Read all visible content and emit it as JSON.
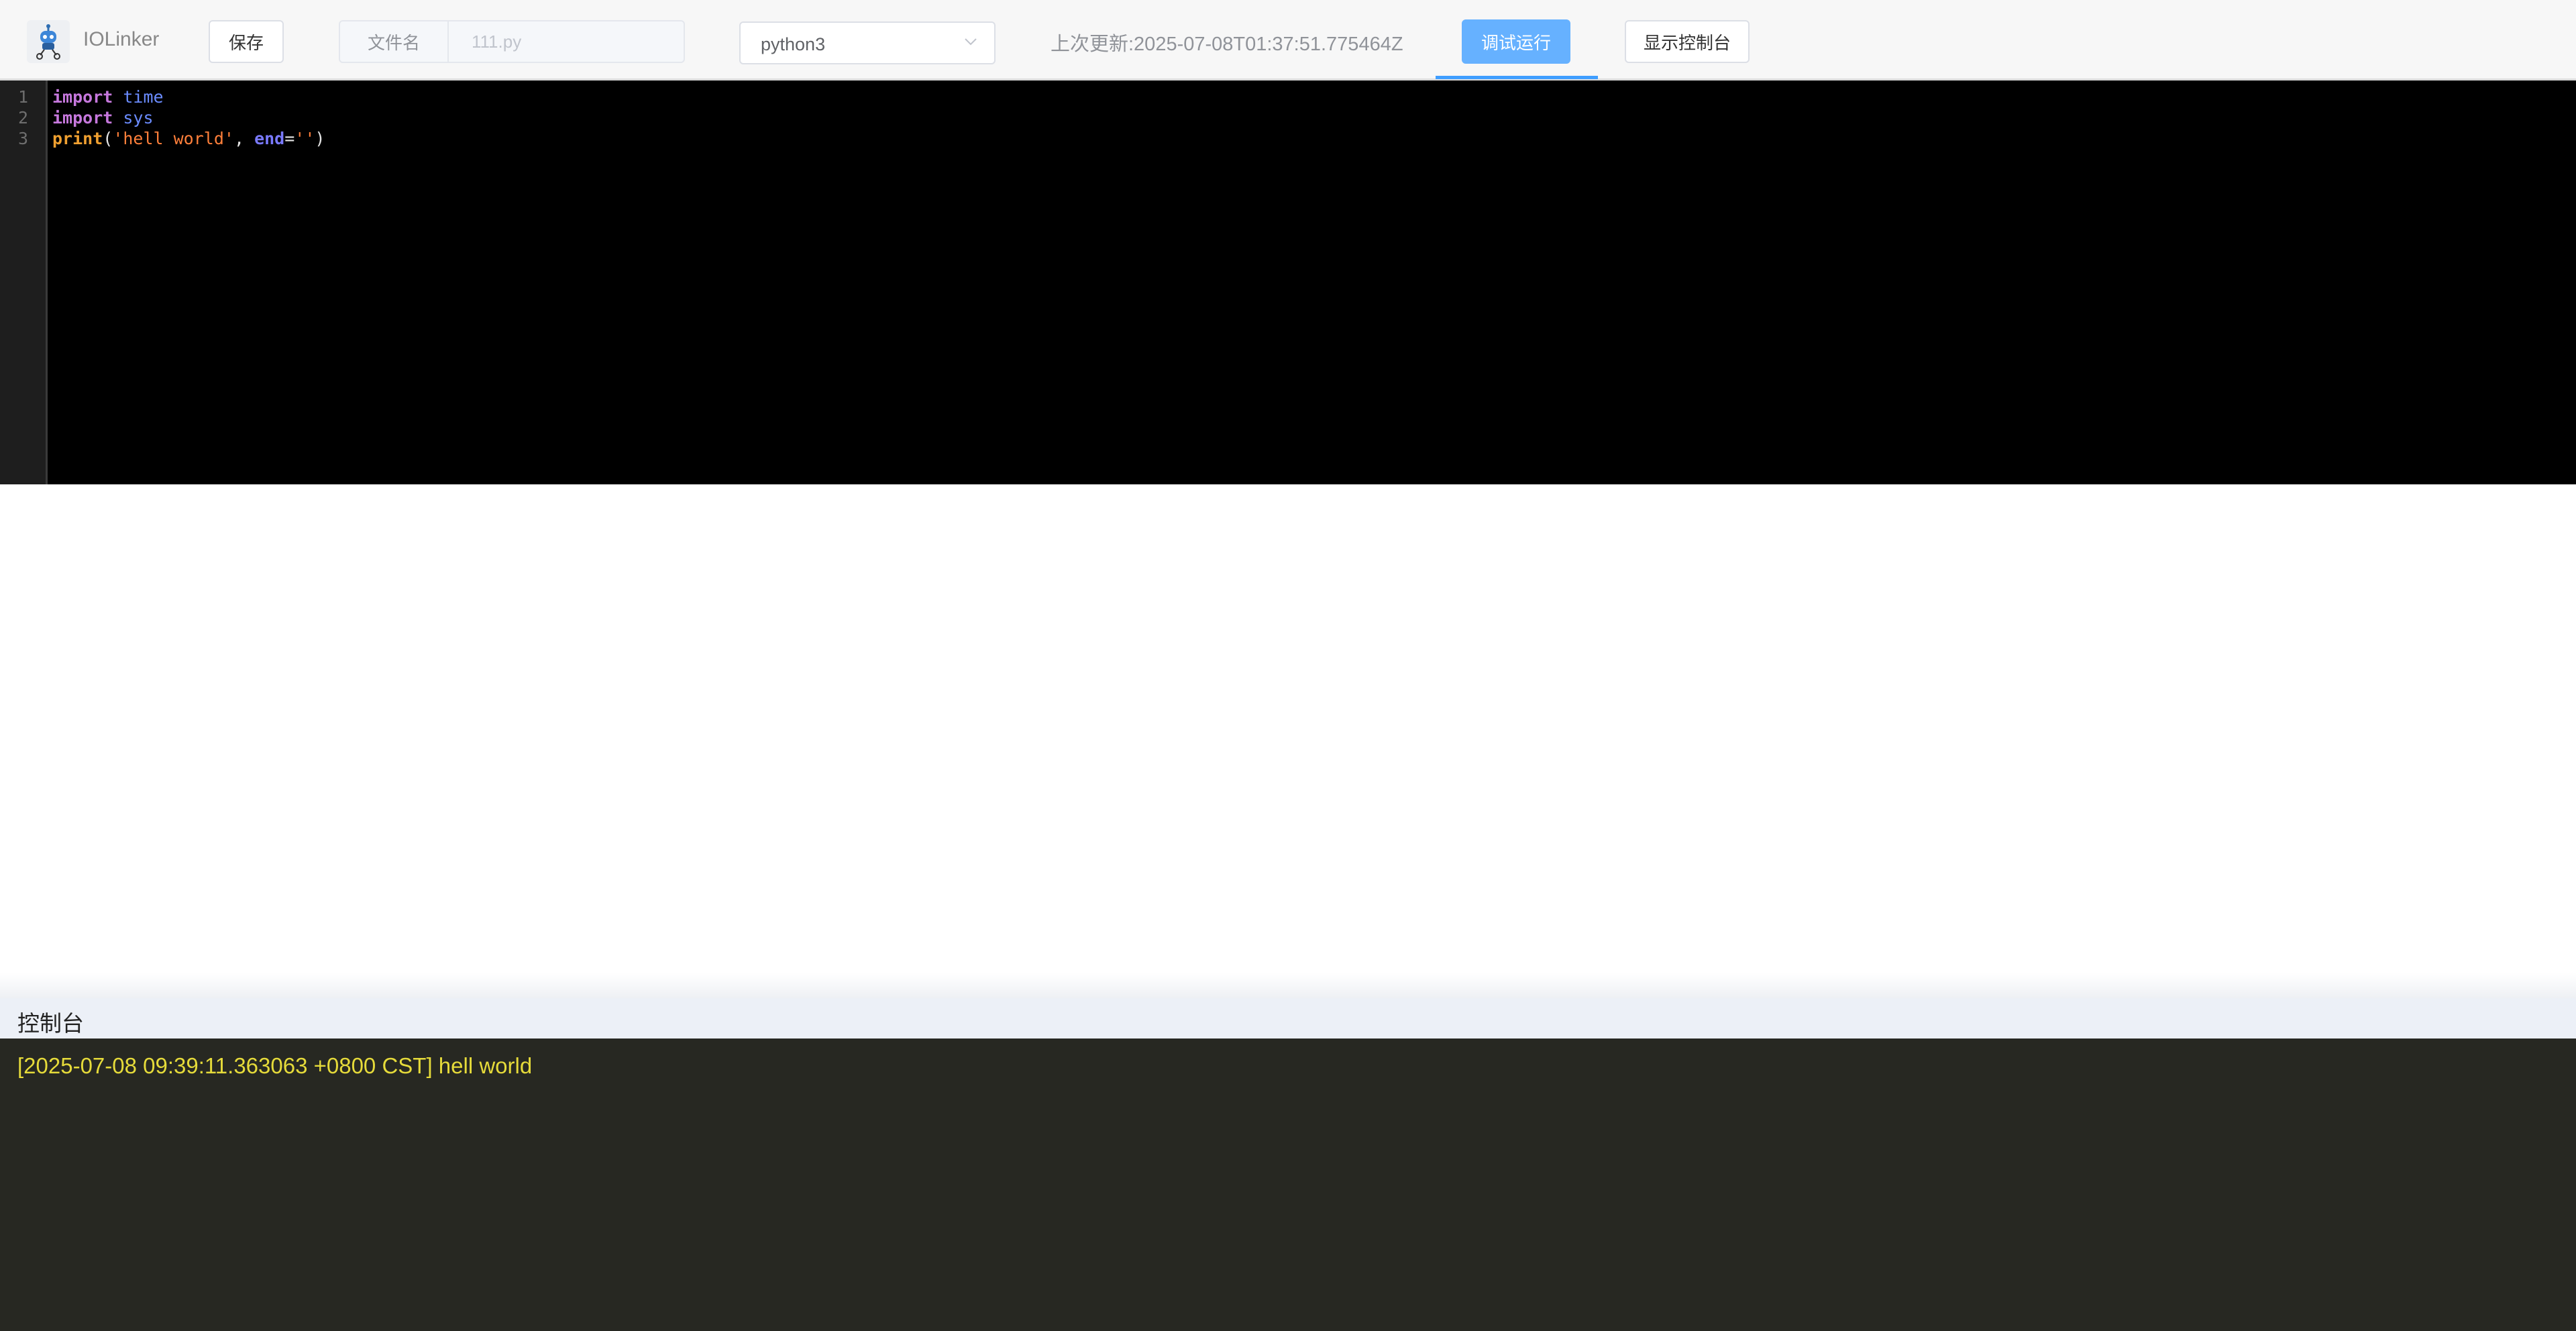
{
  "app": {
    "name": "IOLinker"
  },
  "toolbar": {
    "save_label": "保存",
    "filename_label": "文件名",
    "filename_placeholder": "111.py",
    "language_selected": "python3",
    "last_update": "上次更新:2025-07-08T01:37:51.775464Z",
    "run_label": "调试运行",
    "console_toggle_label": "显示控制台"
  },
  "editor": {
    "line_numbers": [
      "1",
      "2",
      "3"
    ],
    "lines": [
      [
        {
          "t": "import",
          "c": "kw"
        },
        {
          "t": " ",
          "c": "pun"
        },
        {
          "t": "time",
          "c": "mod"
        }
      ],
      [
        {
          "t": "import",
          "c": "kw"
        },
        {
          "t": " ",
          "c": "pun"
        },
        {
          "t": "sys",
          "c": "mod"
        }
      ],
      [
        {
          "t": "print",
          "c": "fn"
        },
        {
          "t": "(",
          "c": "pun"
        },
        {
          "t": "'hell world'",
          "c": "str"
        },
        {
          "t": ", ",
          "c": "pun"
        },
        {
          "t": "end",
          "c": "param"
        },
        {
          "t": "=",
          "c": "pun"
        },
        {
          "t": "''",
          "c": "str"
        },
        {
          "t": ")",
          "c": "pun"
        }
      ]
    ]
  },
  "console": {
    "title": "控制台",
    "logs": [
      "[2025-07-08 09:39:11.363063 +0800 CST] hell world"
    ]
  },
  "colors": {
    "accent": "#66b1ff",
    "editor_bg": "#000000",
    "console_bg": "#272822",
    "console_text": "#e6db3a"
  },
  "icons": {
    "logo": "robot-logo-icon",
    "select_arrow": "chevron-down-icon"
  }
}
